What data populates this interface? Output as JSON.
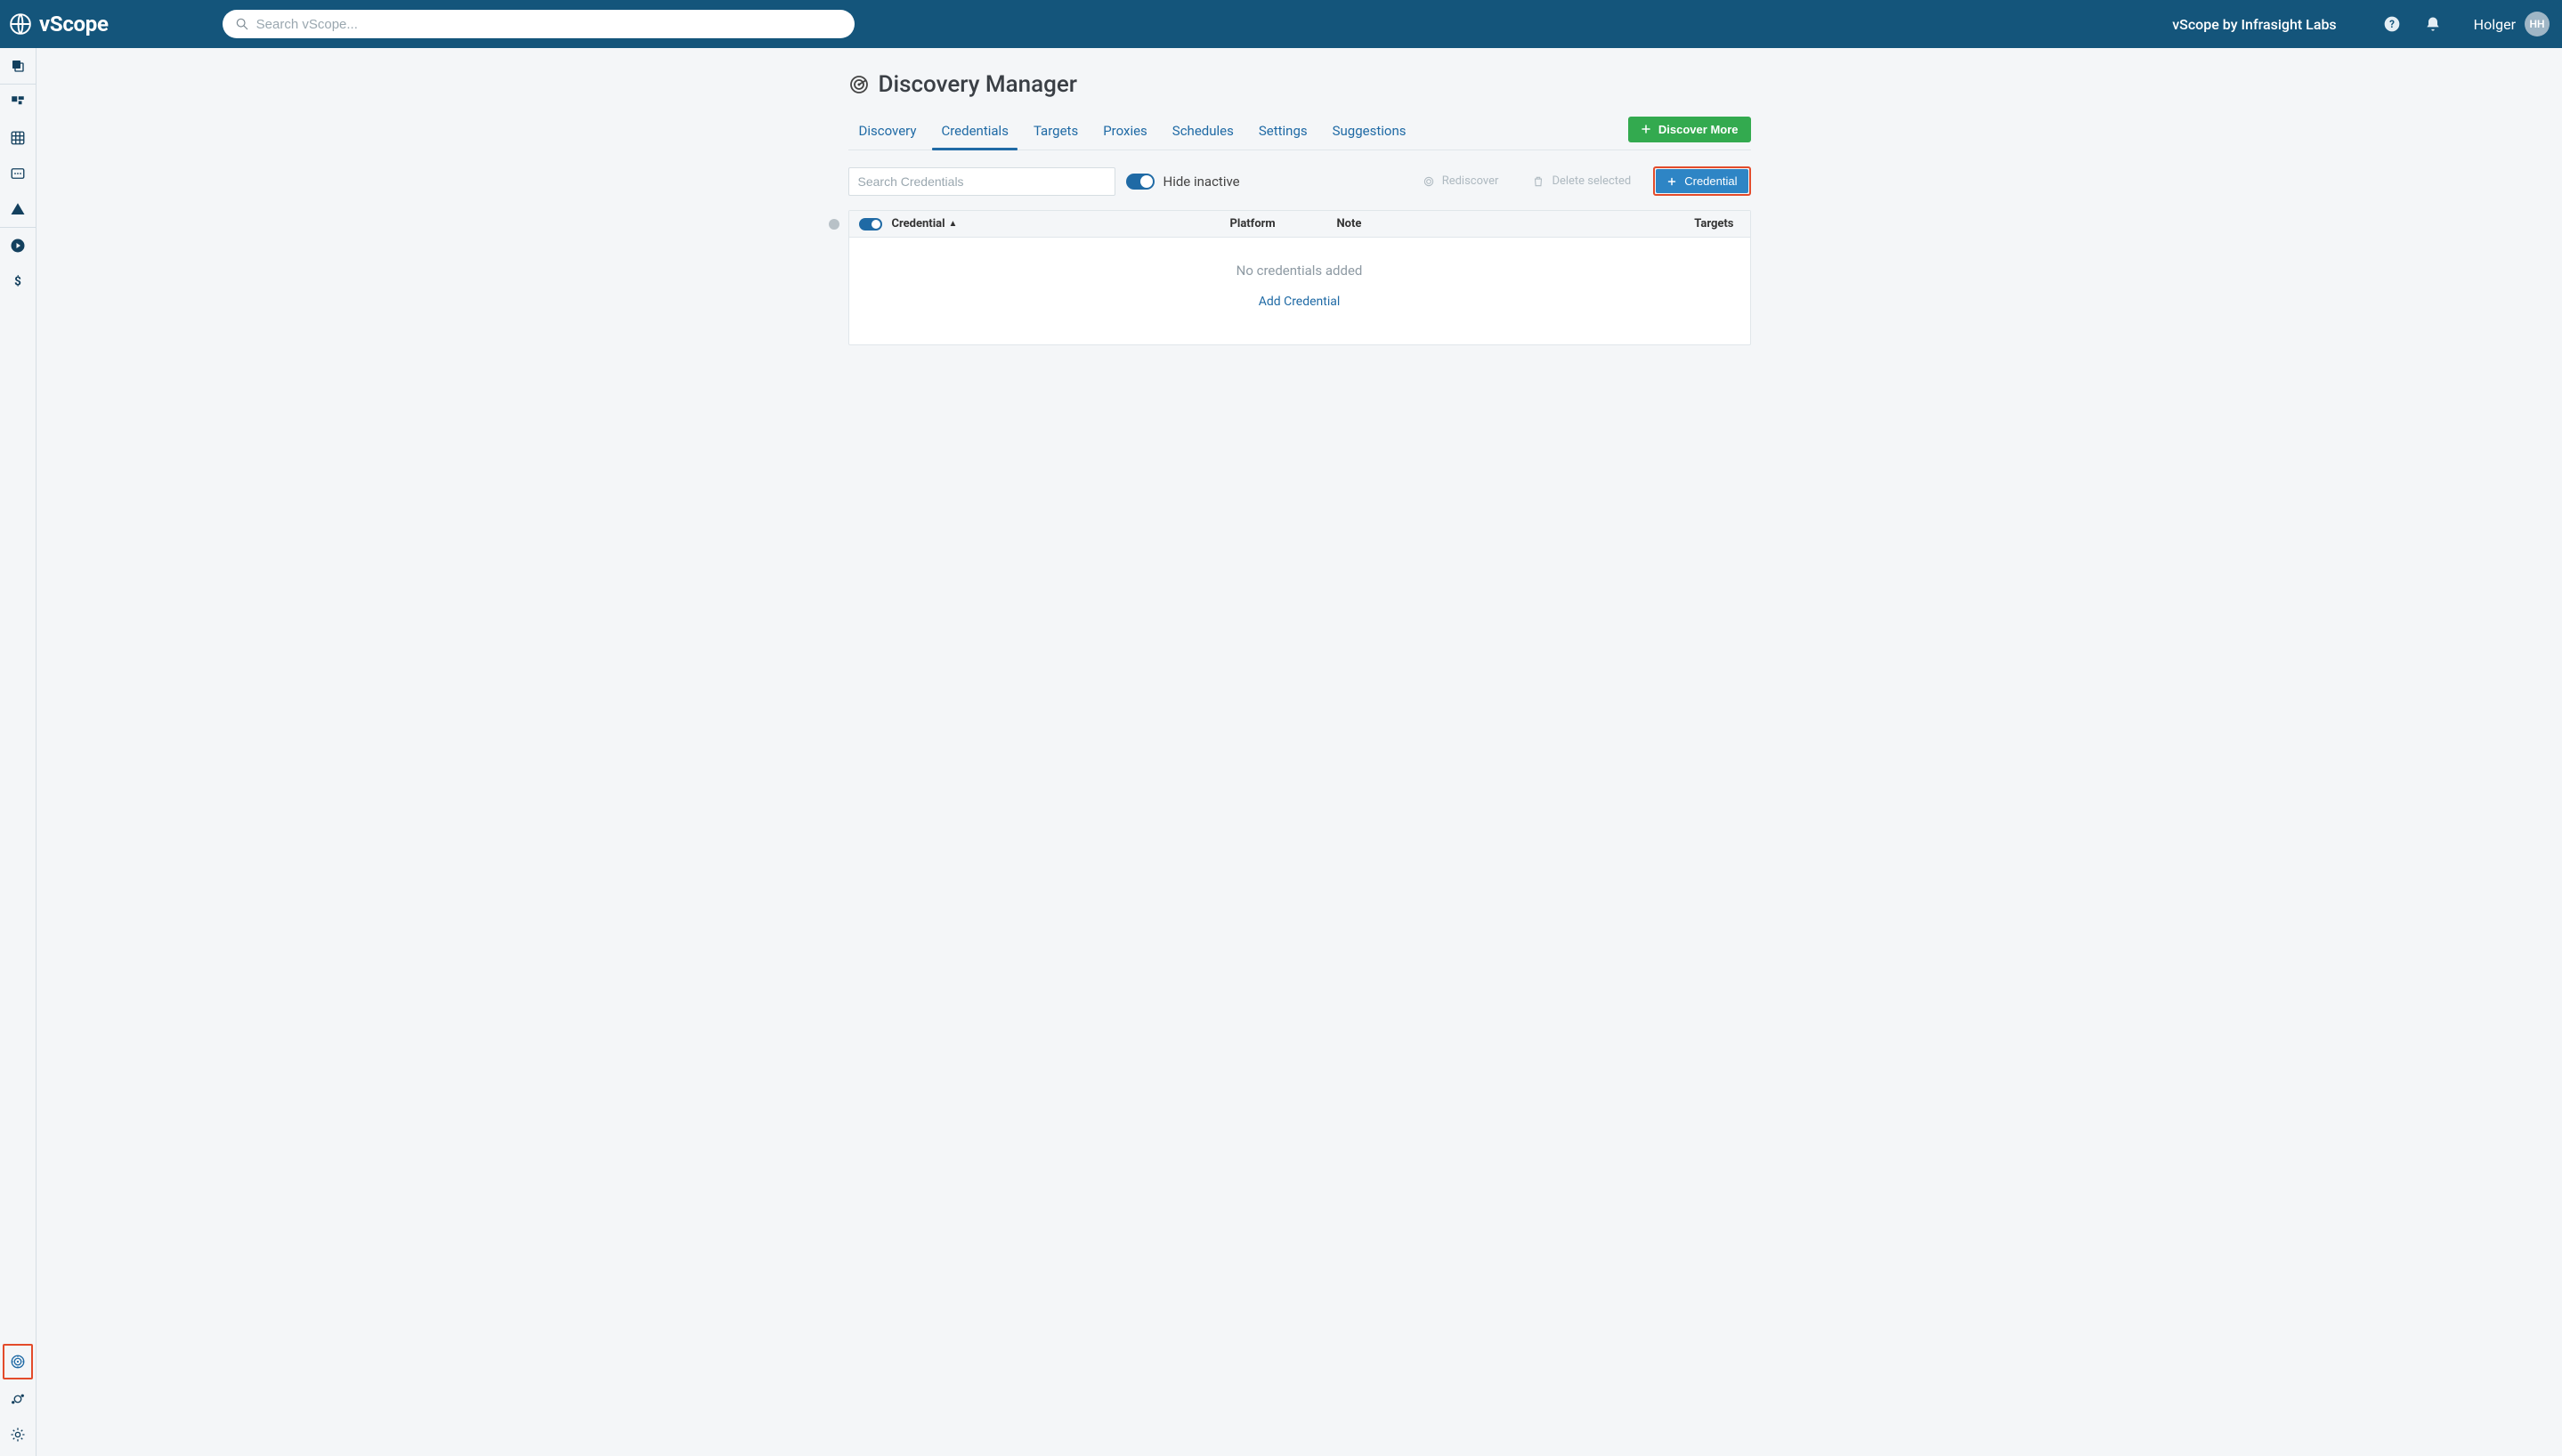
{
  "brand": {
    "name": "vScope"
  },
  "topbar": {
    "search_placeholder": "Search vScope...",
    "org_text": "vScope by Infrasight Labs",
    "user_name": "Holger",
    "user_initials": "HH"
  },
  "page": {
    "title": "Discovery Manager",
    "tabs": [
      {
        "label": "Discovery"
      },
      {
        "label": "Credentials",
        "active": true
      },
      {
        "label": "Targets"
      },
      {
        "label": "Proxies"
      },
      {
        "label": "Schedules"
      },
      {
        "label": "Settings"
      },
      {
        "label": "Suggestions"
      }
    ],
    "discover_more_label": "Discover More"
  },
  "toolbar": {
    "search_placeholder": "Search Credentials",
    "hide_inactive_label": "Hide inactive",
    "rediscover_label": "Rediscover",
    "delete_selected_label": "Delete selected",
    "add_credential_label": "Credential"
  },
  "table": {
    "columns": {
      "credential": "Credential",
      "platform": "Platform",
      "note": "Note",
      "targets": "Targets"
    },
    "empty_text": "No credentials added",
    "add_link_label": "Add Credential"
  }
}
